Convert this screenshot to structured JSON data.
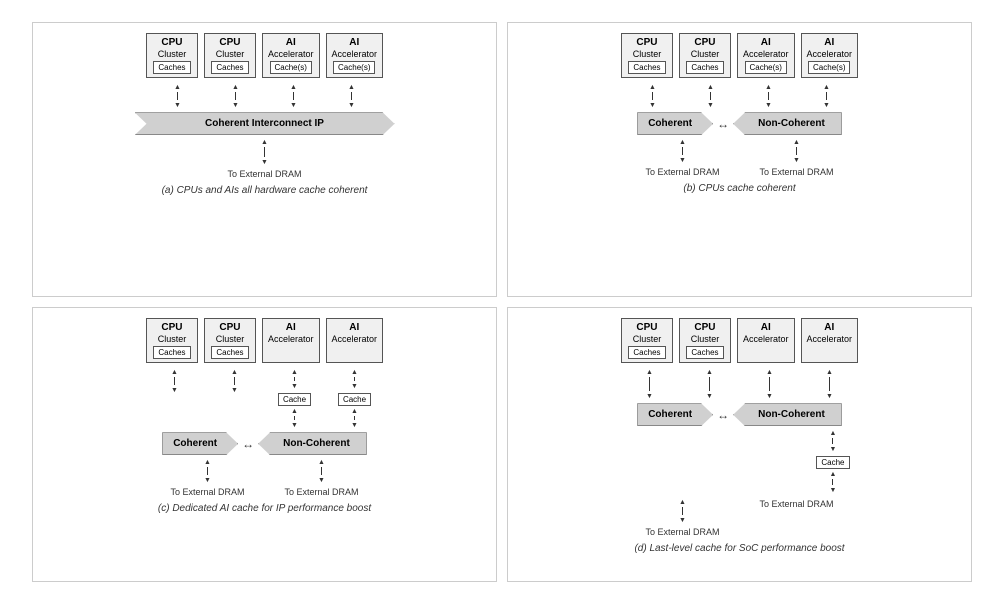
{
  "diagrams": [
    {
      "id": "a",
      "caption": "(a) CPUs and AIs all hardware cache coherent",
      "clusters": [
        {
          "title": "CPU",
          "subtitle": "Cluster",
          "cache": "Caches"
        },
        {
          "title": "CPU",
          "subtitle": "Cluster",
          "cache": "Caches"
        },
        {
          "title": "AI",
          "subtitle": "Accelerator",
          "cache": "Cache(s)"
        },
        {
          "title": "AI",
          "subtitle": "Accelerator",
          "cache": "Cache(s)"
        }
      ],
      "type": "single_banner",
      "banner_text": "Coherent Interconnect IP",
      "dram_labels": [
        "To External DRAM"
      ]
    },
    {
      "id": "b",
      "caption": "(b) CPUs cache coherent",
      "clusters": [
        {
          "title": "CPU",
          "subtitle": "Cluster",
          "cache": "Caches"
        },
        {
          "title": "CPU",
          "subtitle": "Cluster",
          "cache": "Caches"
        },
        {
          "title": "AI",
          "subtitle": "Accelerator",
          "cache": "Cache(s)"
        },
        {
          "title": "AI",
          "subtitle": "Accelerator",
          "cache": "Cache(s)"
        }
      ],
      "type": "two_banners",
      "banner_left": "Coherent",
      "banner_right": "Non-Coherent",
      "dram_labels": [
        "To External DRAM",
        "To External DRAM"
      ]
    },
    {
      "id": "c",
      "caption": "(c) Dedicated AI cache for IP performance boost",
      "clusters": [
        {
          "title": "CPU",
          "subtitle": "Cluster",
          "cache": "Caches"
        },
        {
          "title": "CPU",
          "subtitle": "Cluster",
          "cache": "Caches"
        },
        {
          "title": "AI",
          "subtitle": "Accelerator",
          "cache": null
        },
        {
          "title": "AI",
          "subtitle": "Accelerator",
          "cache": null
        }
      ],
      "type": "two_banners_with_cache",
      "banner_left": "Coherent",
      "banner_right": "Non-Coherent",
      "middle_cache": "Cache",
      "dram_labels": [
        "To External DRAM",
        "To External DRAM"
      ]
    },
    {
      "id": "d",
      "caption": "(d) Last-level cache for SoC performance boost",
      "clusters": [
        {
          "title": "CPU",
          "subtitle": "Cluster",
          "cache": "Caches"
        },
        {
          "title": "CPU",
          "subtitle": "Cluster",
          "cache": "Caches"
        },
        {
          "title": "AI",
          "subtitle": "Accelerator",
          "cache": null
        },
        {
          "title": "AI",
          "subtitle": "Accelerator",
          "cache": null
        }
      ],
      "type": "two_banners_bottom_cache",
      "banner_left": "Coherent",
      "banner_right": "Non-Coherent",
      "bottom_cache": "Cache",
      "dram_labels": [
        "To External DRAM",
        "To External DRAM"
      ]
    }
  ]
}
